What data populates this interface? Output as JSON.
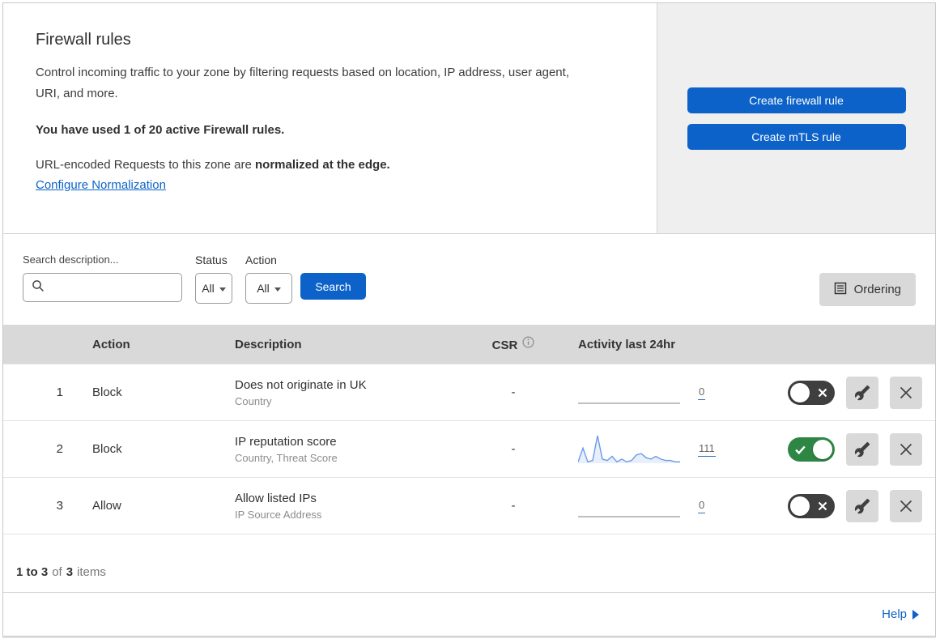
{
  "colors": {
    "accent_blue": "#0c62c8",
    "toggle_on_green": "#2e8644",
    "toggle_off_dark": "#3f3f3f",
    "sparkline_blue": "#6c9ae6",
    "table_header_gray": "#d9d9d9"
  },
  "header": {
    "title": "Firewall rules",
    "description": "Control incoming traffic to your zone by filtering requests based on location, IP address, user agent, URI, and more.",
    "usage_line": "You have used 1 of 20 active Firewall rules.",
    "normalization_prefix": "URL-encoded Requests to this zone are ",
    "normalization_bold": "normalized at the edge.",
    "normalization_link": "Configure Normalization",
    "create_firewall_button": "Create firewall rule",
    "create_mtls_button": "Create mTLS rule"
  },
  "filters": {
    "search_label": "Search description...",
    "status_label": "Status",
    "status_value": "All",
    "action_label": "Action",
    "action_value": "All",
    "search_button": "Search",
    "ordering_button": "Ordering"
  },
  "table": {
    "columns": {
      "action": "Action",
      "description": "Description",
      "csr": "CSR",
      "activity": "Activity last 24hr"
    },
    "rows": [
      {
        "priority": "1",
        "action": "Block",
        "description": "Does not originate in UK",
        "fields": "Country",
        "csr": "-",
        "activity_count": "0",
        "enabled": false,
        "sparkline": [
          0,
          0,
          0,
          0,
          0,
          0,
          0,
          0,
          0,
          0,
          0,
          0,
          0,
          0,
          0,
          0,
          0,
          0,
          0,
          0,
          0,
          0
        ]
      },
      {
        "priority": "2",
        "action": "Block",
        "description": "IP reputation score",
        "fields": "Country, Threat Score",
        "csr": "-",
        "activity_count": "111",
        "enabled": true,
        "sparkline": [
          1,
          11,
          1,
          2,
          20,
          3,
          2,
          5,
          1,
          3,
          1,
          2,
          6,
          7,
          4,
          3,
          5,
          3,
          2,
          2,
          1,
          1
        ]
      },
      {
        "priority": "3",
        "action": "Allow",
        "description": "Allow listed IPs",
        "fields": "IP Source Address",
        "csr": "-",
        "activity_count": "0",
        "enabled": false,
        "sparkline": [
          0,
          0,
          0,
          0,
          0,
          0,
          0,
          0,
          0,
          0,
          0,
          0,
          0,
          0,
          0,
          0,
          0,
          0,
          0,
          0,
          0,
          0
        ]
      }
    ]
  },
  "footer": {
    "range": "1 to 3",
    "of_text": "of",
    "total": "3",
    "items_text": "items",
    "help_link": "Help"
  }
}
